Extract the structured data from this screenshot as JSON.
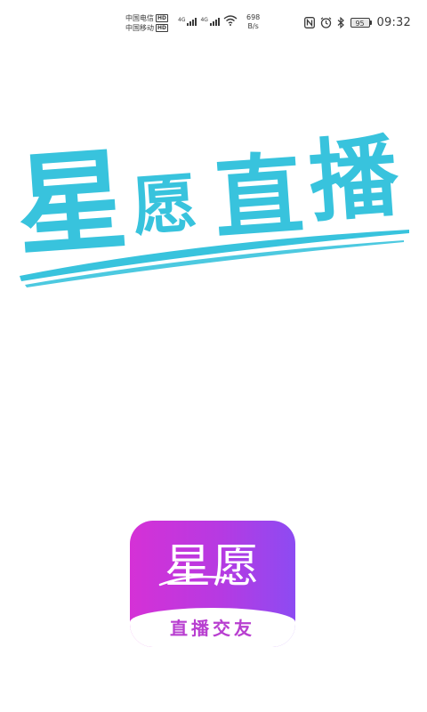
{
  "status_bar": {
    "carrier_1": "中国电信",
    "carrier_2": "中国移动",
    "hd_1": "HD",
    "hd_2": "HD",
    "sig1_tag": "4G",
    "sig2_tag": "4G",
    "net_speed_value": "698",
    "net_speed_unit": "B/s",
    "battery_level": "95",
    "time": "09:32",
    "icons": [
      "nfc-icon",
      "alarm-icon",
      "bluetooth-icon",
      "wifi-icon",
      "signal-icon",
      "battery-icon"
    ]
  },
  "splash": {
    "title_chars": [
      "星",
      "愿",
      "直",
      "播"
    ],
    "title_color": "#38c3dd"
  },
  "logo": {
    "name": "星愿",
    "tagline": "直播交友",
    "gradient_start": "#d531d6",
    "gradient_end": "#8d4bf2"
  }
}
